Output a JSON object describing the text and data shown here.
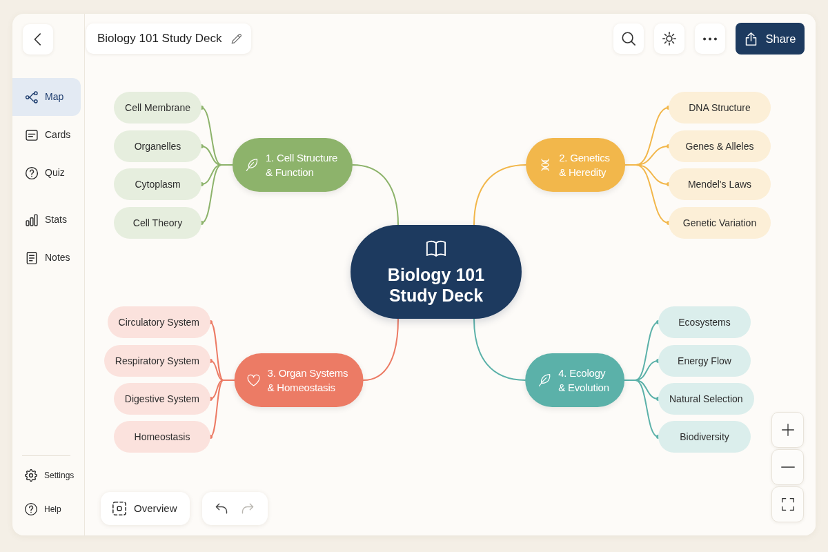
{
  "header": {
    "title": "Biology 101 Study Deck",
    "share_label": "Share"
  },
  "sidebar": {
    "items": [
      {
        "label": "Map",
        "selected": true
      },
      {
        "label": "Cards",
        "selected": false
      },
      {
        "label": "Quiz",
        "selected": false
      },
      {
        "label": "Stats",
        "selected": false
      },
      {
        "label": "Notes",
        "selected": false
      }
    ],
    "footer_items": [
      {
        "label": "Settings"
      },
      {
        "label": "Help"
      }
    ]
  },
  "mind_map": {
    "center_lines": [
      "Biology 101",
      "Study Deck"
    ],
    "branches": [
      {
        "title_lines": [
          "1. Cell Structure",
          "& Function"
        ],
        "color": "#8db36b",
        "topics": [
          "Cell Membrane",
          "Organelles",
          "Cytoplasm",
          "Cell Theory"
        ]
      },
      {
        "title_lines": [
          "2. Genetics",
          "& Heredity"
        ],
        "color": "#f2b74b",
        "topics": [
          "DNA Structure",
          "Genes & Alleles",
          "Mendel's Laws",
          "Genetic Variation"
        ]
      },
      {
        "title_lines": [
          "3. Organ Systems",
          "& Homeostasis"
        ],
        "color": "#ec7b65",
        "topics": [
          "Circulatory System",
          "Respiratory System",
          "Digestive System",
          "Homeostasis"
        ]
      },
      {
        "title_lines": [
          "4. Ecology",
          "& Evolution"
        ],
        "color": "#5bb1a9",
        "topics": [
          "Ecosystems",
          "Energy Flow",
          "Natural Selection",
          "Biodiversity"
        ]
      }
    ]
  },
  "bottom_toolbar": {
    "overview_label": "Overview",
    "undo": {
      "disabled": false
    },
    "redo": {
      "disabled": true
    }
  }
}
